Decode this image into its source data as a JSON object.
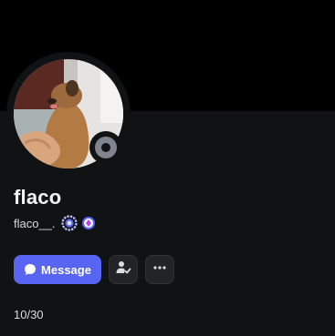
{
  "profile": {
    "display_name": "flaco",
    "username": "flaco__.",
    "status": "offline"
  },
  "actions": {
    "message_label": "Message",
    "add_friend_icon": "person-add-icon",
    "more_icon": "more-dots-icon"
  },
  "counter": "10/30",
  "colors": {
    "background": "#111214",
    "banner": "#000000",
    "primary_button": "#5865f2",
    "status_offline": "#80848e",
    "secondary_button": "#232428"
  }
}
